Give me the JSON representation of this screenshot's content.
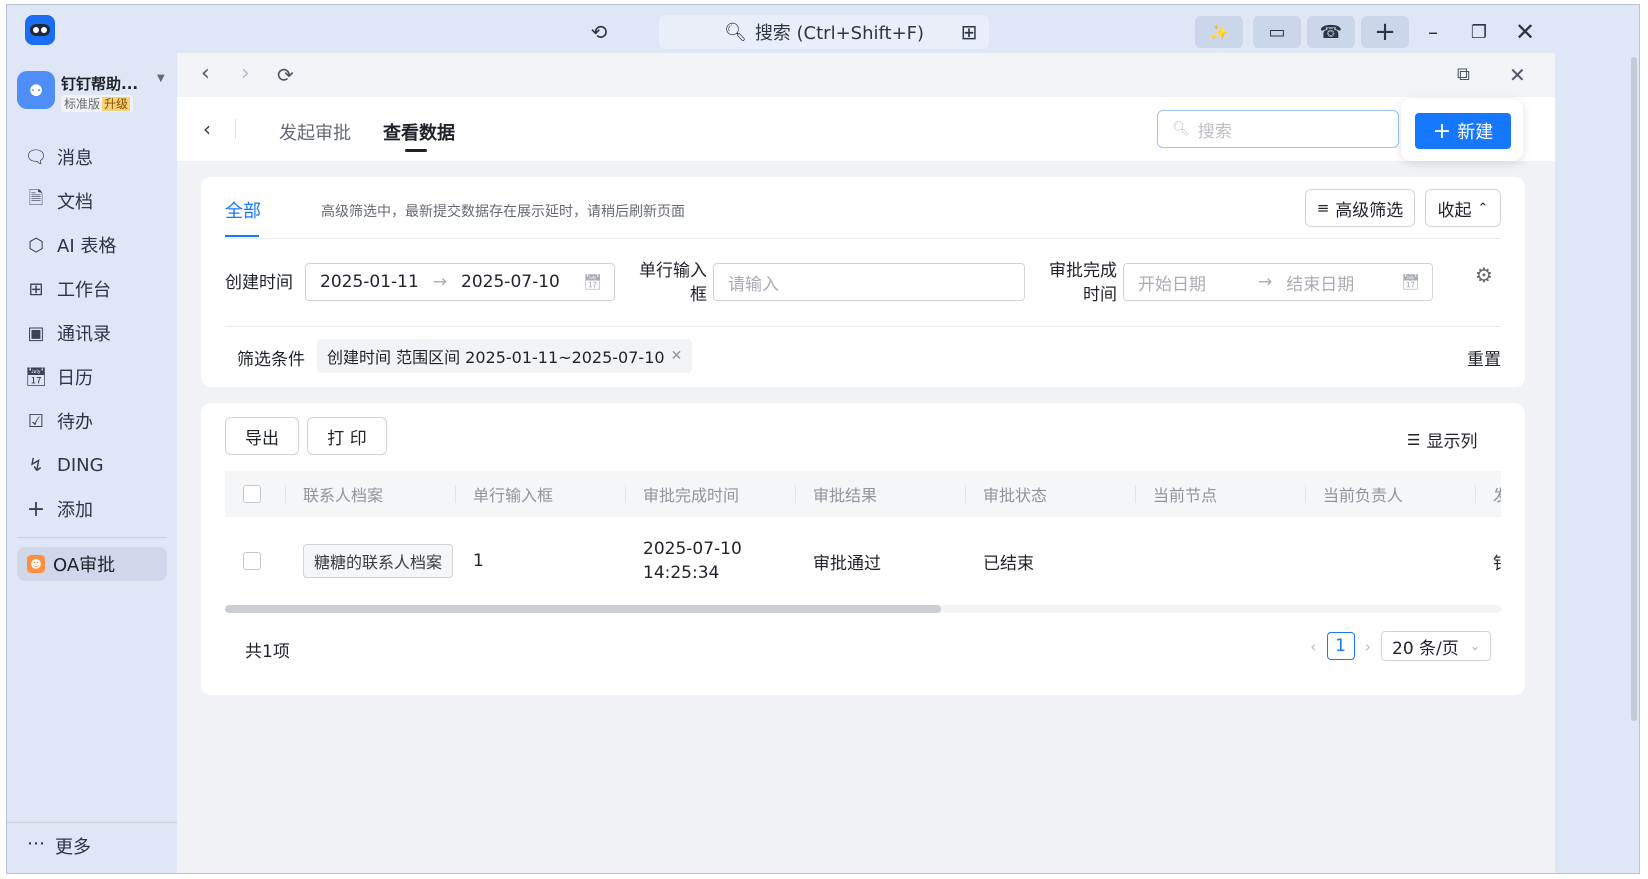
{
  "titlebar": {
    "search_placeholder": "搜索 (Ctrl+Shift+F)",
    "icons": [
      "history-icon",
      "search-icon",
      "apps-icon",
      "ai-icon",
      "screen-cast-icon",
      "call-icon",
      "plus-icon",
      "minimize-icon",
      "restore-icon",
      "close-icon"
    ]
  },
  "sidebar": {
    "org_name": "钉钉帮助...",
    "edition": "标准版",
    "upgrade": "升级",
    "items": [
      {
        "label": "消息",
        "icon": "message-icon"
      },
      {
        "label": "文档",
        "icon": "document-icon"
      },
      {
        "label": "AI 表格",
        "icon": "ai-table-icon"
      },
      {
        "label": "工作台",
        "icon": "workbench-icon"
      },
      {
        "label": "通讯录",
        "icon": "contacts-icon"
      },
      {
        "label": "日历",
        "icon": "calendar-icon"
      },
      {
        "label": "待办",
        "icon": "todo-icon"
      },
      {
        "label": "DING",
        "icon": "ding-icon"
      },
      {
        "label": "添加",
        "icon": "add-icon"
      }
    ],
    "active_app": "OA审批",
    "more": "更多"
  },
  "page_header": {
    "tabs": [
      "发起审批",
      "查看数据"
    ],
    "active_tab": "查看数据",
    "search_placeholder": "搜索",
    "new_button": "新建"
  },
  "filter": {
    "tab_all": "全部",
    "hint": "高级筛选中，最新提交数据存在展示延时，请稍后刷新页面",
    "advanced_filter": "高级筛选",
    "collapse": "收起",
    "fields": {
      "created_label": "创建时间",
      "created_start": "2025-01-11",
      "created_end": "2025-07-10",
      "single_line_label": "单行输入框",
      "single_line_placeholder": "请输入",
      "approval_done_label": "审批完成时间",
      "start_placeholder": "开始日期",
      "end_placeholder": "结束日期"
    },
    "conditions_label": "筛选条件",
    "condition_tag": "创建时间 范围区间 2025-01-11~2025-07-10",
    "reset": "重置"
  },
  "table": {
    "export": "导出",
    "print": "打 印",
    "show_columns": "显示列",
    "columns": [
      "联系人档案",
      "单行输入框",
      "审批完成时间",
      "审批结果",
      "审批状态",
      "当前节点",
      "当前负责人",
      "发"
    ],
    "rows": [
      {
        "contact": "糖糖的联系人档案",
        "single_line": "1",
        "done_date": "2025-07-10",
        "done_time": "14:25:34",
        "result": "审批通过",
        "status": "已结束",
        "node": "",
        "owner": "",
        "extra": "钉"
      }
    ],
    "total": "共1项",
    "current_page": "1",
    "page_size": "20 条/页"
  }
}
